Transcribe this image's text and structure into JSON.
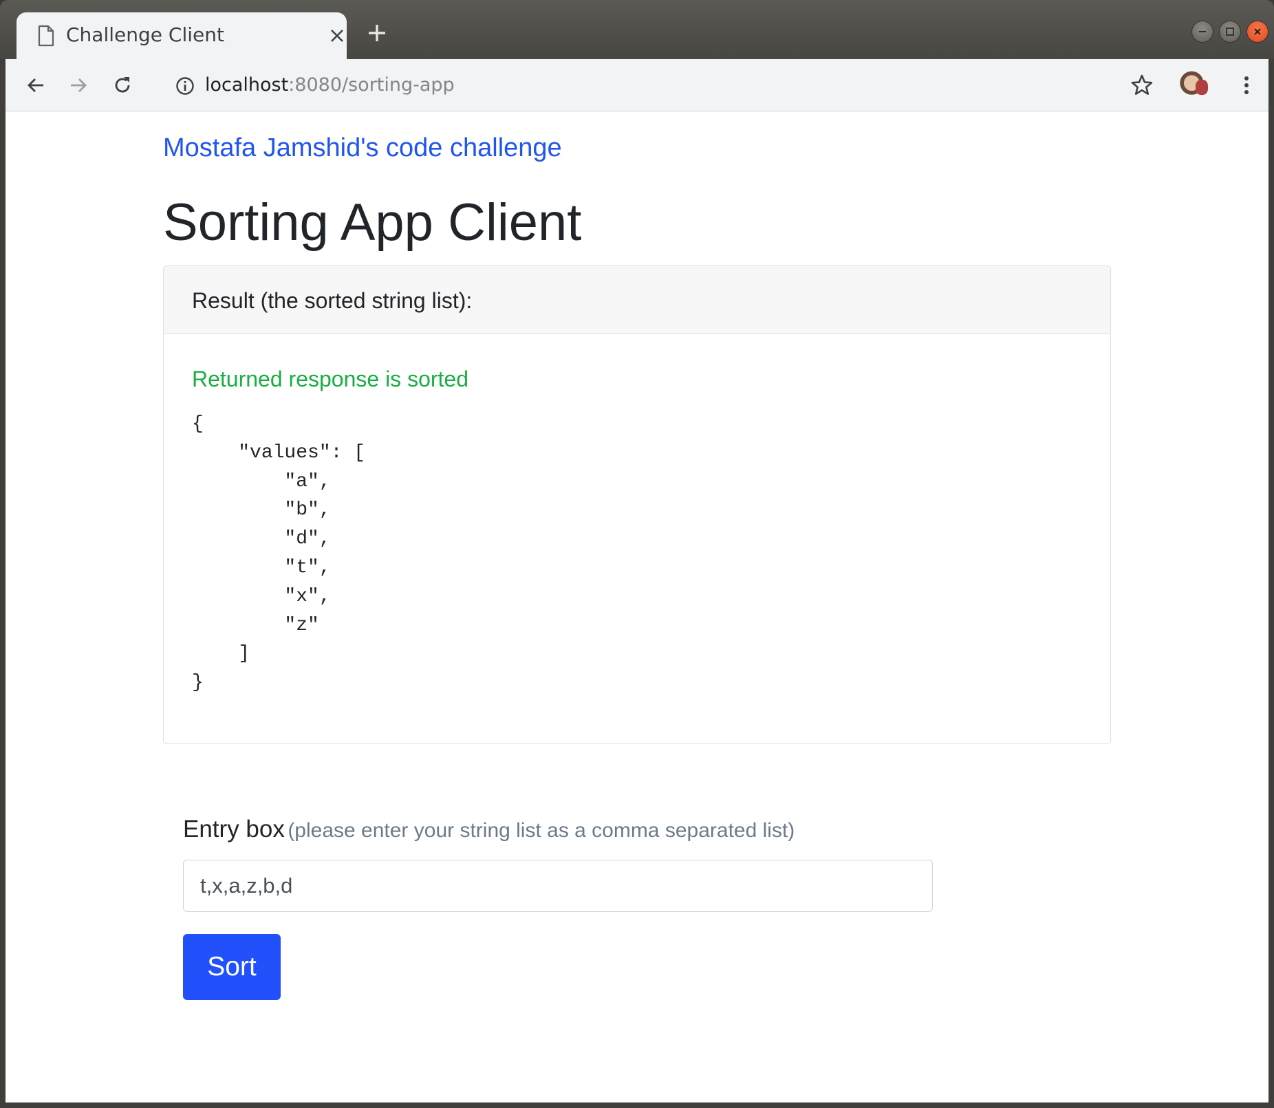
{
  "browser": {
    "tab_title": "Challenge Client",
    "tab_close_icon": "close-icon",
    "url_host": "localhost",
    "url_path": ":8080/sorting-app",
    "icons": [
      "back-arrow-icon",
      "forward-arrow-icon",
      "reload-icon",
      "info-icon",
      "star-icon",
      "menu-dots-icon"
    ]
  },
  "page": {
    "brand": "Mostafa Jamshid's code challenge",
    "title": "Sorting App Client"
  },
  "result": {
    "header": "Result (the sorted string list):",
    "status": "Returned response is sorted",
    "json_text": "{\n    \"values\": [\n        \"a\",\n        \"b\",\n        \"d\",\n        \"t\",\n        \"x\",\n        \"z\"\n    ]\n}"
  },
  "entry": {
    "label": "Entry box",
    "hint": "(please enter your string list as a comma separated list)",
    "value": "t,x,a,z,b,d"
  },
  "actions": {
    "sort_label": "Sort"
  },
  "colors": {
    "brand_link": "#2155f0",
    "success": "#19ae42",
    "primary_button": "#2251fb"
  }
}
